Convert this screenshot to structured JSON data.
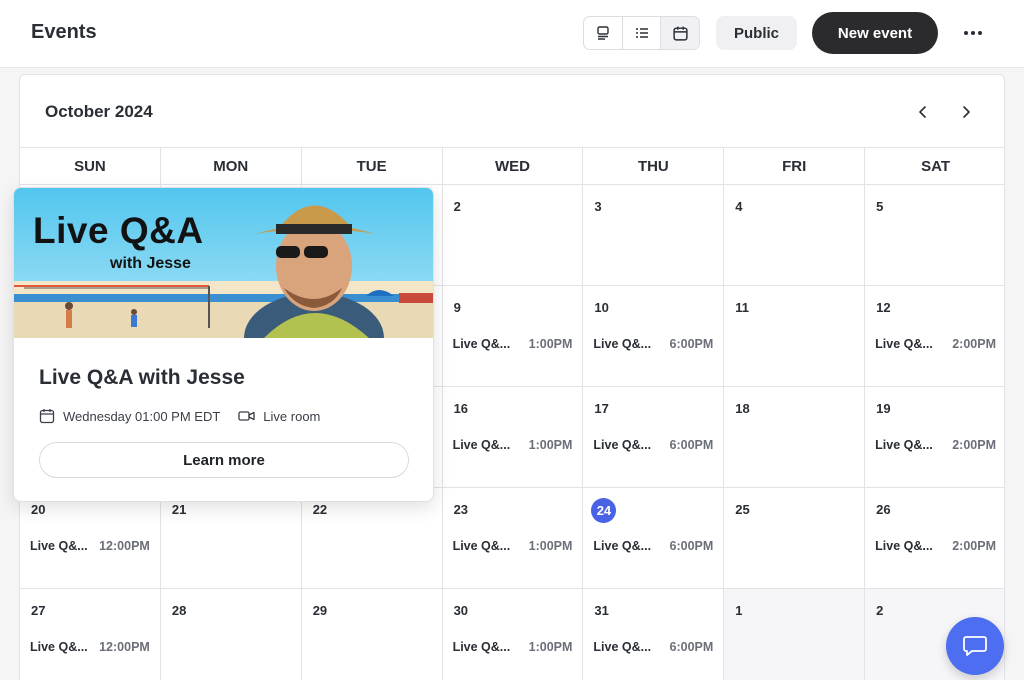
{
  "header": {
    "title": "Events",
    "views": [
      {
        "name": "card-view",
        "icon": "card-view-icon",
        "active": false
      },
      {
        "name": "list-view",
        "icon": "list-view-icon",
        "active": false
      },
      {
        "name": "calendar-view",
        "icon": "calendar-view-icon",
        "active": true
      }
    ],
    "public_label": "Public",
    "new_event_label": "New event",
    "more_icon": "more-horizontal-icon"
  },
  "calendar": {
    "month_label": "October 2024",
    "prev_icon": "chevron-left-icon",
    "next_icon": "chevron-right-icon",
    "weekdays": [
      "SUN",
      "MON",
      "TUE",
      "WED",
      "THU",
      "FRI",
      "SAT"
    ],
    "today": "24",
    "weeks": [
      [
        {
          "day": "",
          "other": false,
          "event": null
        },
        {
          "day": "",
          "other": false,
          "event": null
        },
        {
          "day": "",
          "other": false,
          "event": null
        },
        {
          "day": "2",
          "other": false,
          "event": null
        },
        {
          "day": "3",
          "other": false,
          "event": null
        },
        {
          "day": "4",
          "other": false,
          "event": null
        },
        {
          "day": "5",
          "other": false,
          "event": null
        }
      ],
      [
        {
          "day": "",
          "other": false,
          "event": null
        },
        {
          "day": "",
          "other": false,
          "event": null
        },
        {
          "day": "",
          "other": false,
          "event": null
        },
        {
          "day": "9",
          "other": false,
          "event": {
            "title": "Live Q&...",
            "time": "1:00PM"
          }
        },
        {
          "day": "10",
          "other": false,
          "event": {
            "title": "Live Q&...",
            "time": "6:00PM"
          }
        },
        {
          "day": "11",
          "other": false,
          "event": null
        },
        {
          "day": "12",
          "other": false,
          "event": {
            "title": "Live Q&...",
            "time": "2:00PM"
          }
        }
      ],
      [
        {
          "day": "",
          "other": false,
          "event": null
        },
        {
          "day": "",
          "other": false,
          "event": null
        },
        {
          "day": "",
          "other": false,
          "event": null
        },
        {
          "day": "16",
          "other": false,
          "event": {
            "title": "Live Q&...",
            "time": "1:00PM"
          }
        },
        {
          "day": "17",
          "other": false,
          "event": {
            "title": "Live Q&...",
            "time": "6:00PM"
          }
        },
        {
          "day": "18",
          "other": false,
          "event": null
        },
        {
          "day": "19",
          "other": false,
          "event": {
            "title": "Live Q&...",
            "time": "2:00PM"
          }
        }
      ],
      [
        {
          "day": "20",
          "other": false,
          "event": {
            "title": "Live Q&...",
            "time": "12:00PM"
          }
        },
        {
          "day": "21",
          "other": false,
          "event": null
        },
        {
          "day": "22",
          "other": false,
          "event": null
        },
        {
          "day": "23",
          "other": false,
          "event": {
            "title": "Live Q&...",
            "time": "1:00PM"
          }
        },
        {
          "day": "24",
          "other": false,
          "event": {
            "title": "Live Q&...",
            "time": "6:00PM"
          }
        },
        {
          "day": "25",
          "other": false,
          "event": null
        },
        {
          "day": "26",
          "other": false,
          "event": {
            "title": "Live Q&...",
            "time": "2:00PM"
          }
        }
      ],
      [
        {
          "day": "27",
          "other": false,
          "event": {
            "title": "Live Q&...",
            "time": "12:00PM"
          }
        },
        {
          "day": "28",
          "other": false,
          "event": null
        },
        {
          "day": "29",
          "other": false,
          "event": null
        },
        {
          "day": "30",
          "other": false,
          "event": {
            "title": "Live Q&...",
            "time": "1:00PM"
          }
        },
        {
          "day": "31",
          "other": false,
          "event": {
            "title": "Live Q&...",
            "time": "6:00PM"
          }
        },
        {
          "day": "1",
          "other": true,
          "event": null
        },
        {
          "day": "2",
          "other": true,
          "event": null
        }
      ]
    ]
  },
  "popup": {
    "banner_title": "Live Q&A",
    "banner_subtitle": "with Jesse",
    "title": "Live Q&A with Jesse",
    "date_icon": "calendar-icon",
    "date_text": "Wednesday 01:00 PM EDT",
    "location_icon": "video-camera-icon",
    "location_text": "Live room",
    "learn_more_label": "Learn more"
  },
  "chat": {
    "icon": "chat-bubble-icon"
  },
  "colors": {
    "accent": "#4a63e4",
    "primary_button": "#2b2b2e",
    "chat_button": "#4d6ef0"
  }
}
